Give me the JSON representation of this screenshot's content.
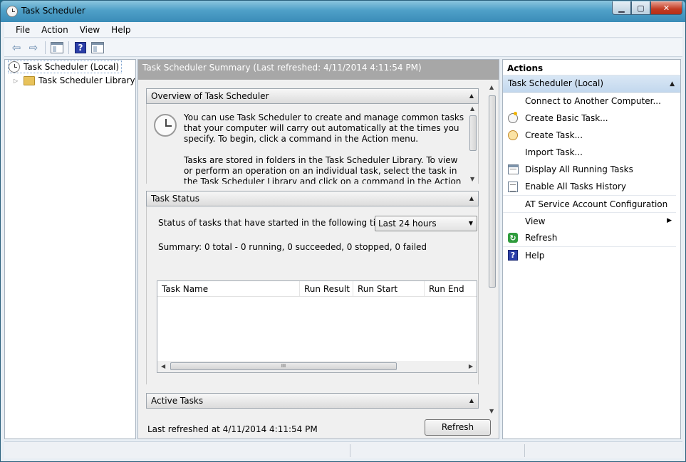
{
  "window": {
    "title": "Task Scheduler",
    "minimize_glyph": "▁",
    "maximize_glyph": "▢",
    "close_glyph": "✕"
  },
  "menu": {
    "items": [
      "File",
      "Action",
      "View",
      "Help"
    ]
  },
  "toolbar": {
    "back_glyph": "⇦",
    "forward_glyph": "⇨",
    "help_glyph": "?"
  },
  "tree": {
    "root_label": "Task Scheduler (Local)",
    "library_label": "Task Scheduler Library",
    "expander_glyph": "▷"
  },
  "center": {
    "header": "Task Scheduler Summary (Last refreshed: 4/11/2014 4:11:54 PM)",
    "overview": {
      "title": "Overview of Task Scheduler",
      "para1": "You can use Task Scheduler to create and manage common tasks that your computer will carry out automatically at the times you specify. To begin, click a command in the Action menu.",
      "para2": "Tasks are stored in folders in the Task Scheduler Library. To view or perform an operation on an individual task, select the task in the Task Scheduler Library and click on a command in the Action menu."
    },
    "task_status": {
      "title": "Task Status",
      "label": "Status of tasks that have started in the following time ...",
      "period": "Last 24 hours",
      "summary": "Summary: 0 total - 0 running, 0 succeeded, 0 stopped, 0 failed",
      "columns": [
        "Task Name",
        "Run Result",
        "Run Start",
        "Run End"
      ],
      "hscroll_grip": "III"
    },
    "active_tasks": {
      "title": "Active Tasks"
    },
    "footer": {
      "last_refreshed": "Last refreshed at 4/11/2014 4:11:54 PM",
      "refresh_label": "Refresh"
    },
    "collapse_glyph": "▲",
    "scroll_up_glyph": "▲",
    "scroll_down_glyph": "▼",
    "scroll_left_glyph": "◀",
    "scroll_right_glyph": "▶",
    "dropdown_glyph": "▼"
  },
  "actions": {
    "title": "Actions",
    "group": "Task Scheduler (Local)",
    "group_glyph": "▲",
    "submenu_glyph": "▶",
    "refresh_glyph": "↻",
    "help_glyph": "?",
    "items": [
      "Connect to Another Computer...",
      "Create Basic Task...",
      "Create Task...",
      "Import Task...",
      "Display All Running Tasks",
      "Enable All Tasks History",
      "AT Service Account Configuration",
      "View",
      "Refresh",
      "Help"
    ]
  }
}
